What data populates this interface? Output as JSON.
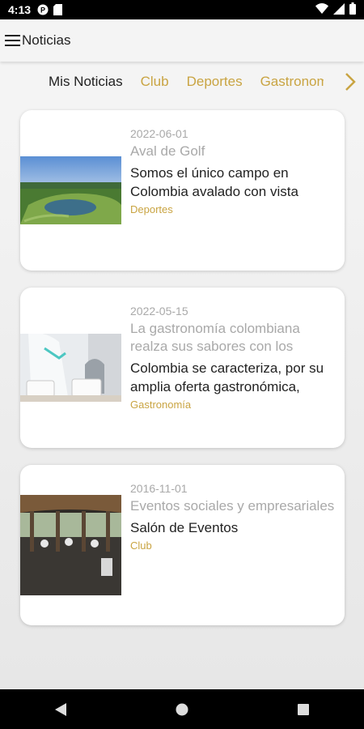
{
  "status_bar": {
    "time": "4:13",
    "icons": [
      "notification-p-icon",
      "sd-card-icon",
      "wifi-icon",
      "signal-icon",
      "battery-icon"
    ]
  },
  "app_bar": {
    "title": "Noticias",
    "menu_icon": "hamburger-menu-icon"
  },
  "tabs": {
    "items": [
      {
        "label": "Mis Noticias",
        "active": true
      },
      {
        "label": "Club",
        "active": false
      },
      {
        "label": "Deportes",
        "active": false
      },
      {
        "label": "Gastronomía",
        "active": false
      }
    ],
    "next_icon": "chevron-right-icon"
  },
  "colors": {
    "accent": "#c9a442",
    "muted_text": "#a9a9a9",
    "primary_text": "#222222",
    "card_bg": "#ffffff"
  },
  "news": [
    {
      "date": "2022-06-01",
      "headline": "Aval de Golf",
      "summary": "Somos el único campo en Colombia avalado con vista",
      "category": "Deportes",
      "image": "golf-course-lake-photo"
    },
    {
      "date": "2022-05-15",
      "headline": "La gastronomía colombiana realza sus sabores con los",
      "summary": "Colombia se caracteriza, por su amplia oferta gastronómica,",
      "category": "Gastronomía",
      "image": "waiter-coffee-service-photo"
    },
    {
      "date": "2016-11-01",
      "headline": "Eventos sociales y empresariales",
      "summary": "Salón de Eventos",
      "category": "Club",
      "image": "events-hall-terrace-photo"
    }
  ],
  "nav_bar": {
    "icons": [
      "back-icon",
      "home-icon",
      "recents-icon"
    ]
  }
}
